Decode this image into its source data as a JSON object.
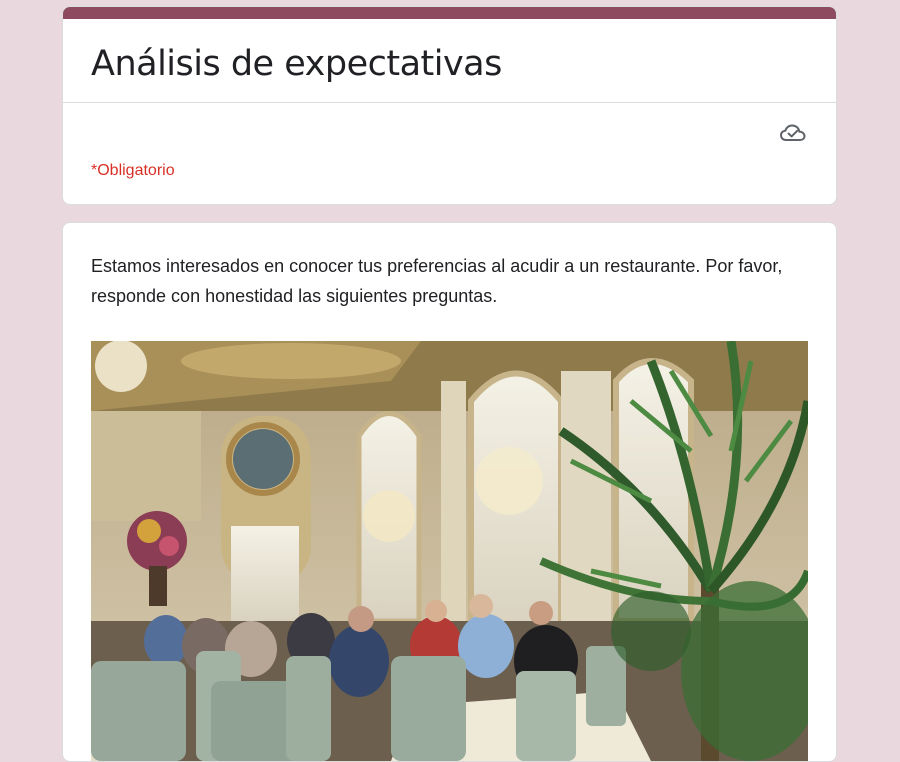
{
  "form": {
    "title": "Análisis de expectativas",
    "required_note": "*Obligatorio",
    "description": "Estamos interesados en conocer tus preferencias al acudir a un restaurante. Por favor, responde con honestidad las siguientes preguntas.",
    "save_status_icon": "cloud-check-icon",
    "image_alt": "Comedor elegante de restaurante con candelabros y palmeras"
  },
  "colors": {
    "background": "#ead8df",
    "accent": "#8e4a5f",
    "required": "#d93025",
    "text": "#202124"
  }
}
